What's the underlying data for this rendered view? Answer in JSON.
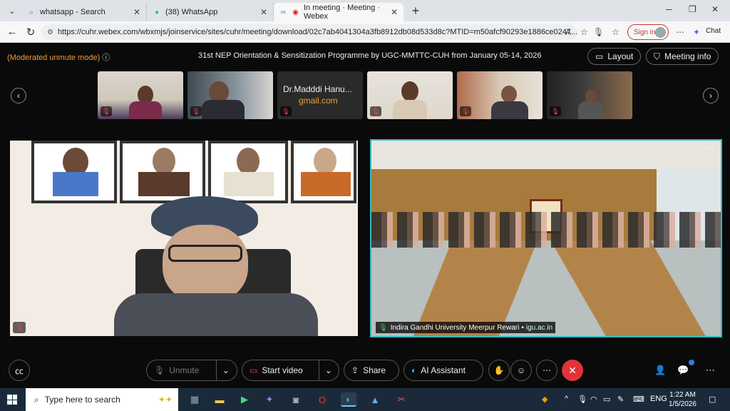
{
  "browser": {
    "tabs": [
      {
        "label": "whatsapp - Search",
        "icon": "search-icon"
      },
      {
        "label": "(38) WhatsApp",
        "icon": "whatsapp-icon"
      },
      {
        "label": "In meeting · Meeting · Webex",
        "icon": "webex-icon"
      }
    ],
    "url": "https://cuhr.webex.com/wbxmjs/joinservice/sites/cuhr/meeting/download/02c7ab4041304a3fb8912db08d533d8c?MTID=m50afcf90293e1886ce0247...",
    "signin_label": "Sign in",
    "chat_label": "Chat"
  },
  "meeting": {
    "mode_label": "(Moderated unmute mode)",
    "title": "31st NEP Orientation & Sensitization Programme by UGC-MMTTC-CUH from January 05-14, 2026",
    "layout_label": "Layout",
    "meeting_info_label": "Meeting info",
    "namecard": {
      "line1": "Dr.Madddi Hanu...",
      "line2": "gmail.com"
    },
    "main_tile_label": {
      "name": "Indira Gandhi University Meerpur Rewari",
      "link": "igu.ac.in"
    },
    "controls": {
      "unmute": "Unmute",
      "start_video": "Start video",
      "share": "Share",
      "ai_assistant": "AI Assistant"
    }
  },
  "taskbar": {
    "search_placeholder": "Type here to search",
    "lang": "ENG",
    "time": "1:22 AM",
    "date": "1/5/2026"
  },
  "colors": {
    "accent_orange": "#f29d38",
    "active_speaker": "#35b8c3",
    "end_call": "#e0333c"
  }
}
